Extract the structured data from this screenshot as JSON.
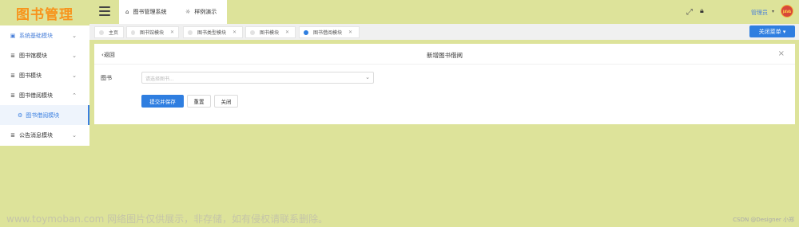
{
  "app": {
    "logo_text": "图书管理"
  },
  "sidebar": {
    "items": [
      {
        "label": "系统基础模块",
        "icon": "grid-icon",
        "expanded": false,
        "active": true
      },
      {
        "label": "图书馆模块",
        "icon": "list-icon",
        "expanded": false
      },
      {
        "label": "图书模块",
        "icon": "list-icon",
        "expanded": false
      },
      {
        "label": "图书借阅模块",
        "icon": "list-icon",
        "expanded": true
      },
      {
        "label": "图书借阅模块",
        "icon": "gear-icon",
        "sub": true
      },
      {
        "label": "公告消息模块",
        "icon": "list-icon",
        "expanded": false
      }
    ]
  },
  "header": {
    "tab1": "图书管理系统",
    "tab2": "样例演示",
    "user": "管理员",
    "avatar_text": "JAVA"
  },
  "tabs": [
    {
      "label": "主页",
      "closable": false,
      "active": false
    },
    {
      "label": "图书馆模块",
      "closable": true,
      "active": false
    },
    {
      "label": "图书类型模块",
      "closable": true,
      "active": false
    },
    {
      "label": "图书模块",
      "closable": true,
      "active": false
    },
    {
      "label": "图书借阅模块",
      "closable": true,
      "active": true
    }
  ],
  "close_menu_label": "关闭菜单",
  "form": {
    "back": "返回",
    "title": "新增图书借阅",
    "field_label": "图书",
    "placeholder": "请选择图书...",
    "submit": "提交并保存",
    "reset": "重置",
    "close": "关闭"
  },
  "watermark": "www.toymoban.com 网络图片仅供展示，非存储，如有侵权请联系删除。",
  "credit": "CSDN @Designer 小郑",
  "colors": {
    "accent": "#2f7ee0",
    "logo": "#f7941d",
    "background": "#dde39a"
  }
}
